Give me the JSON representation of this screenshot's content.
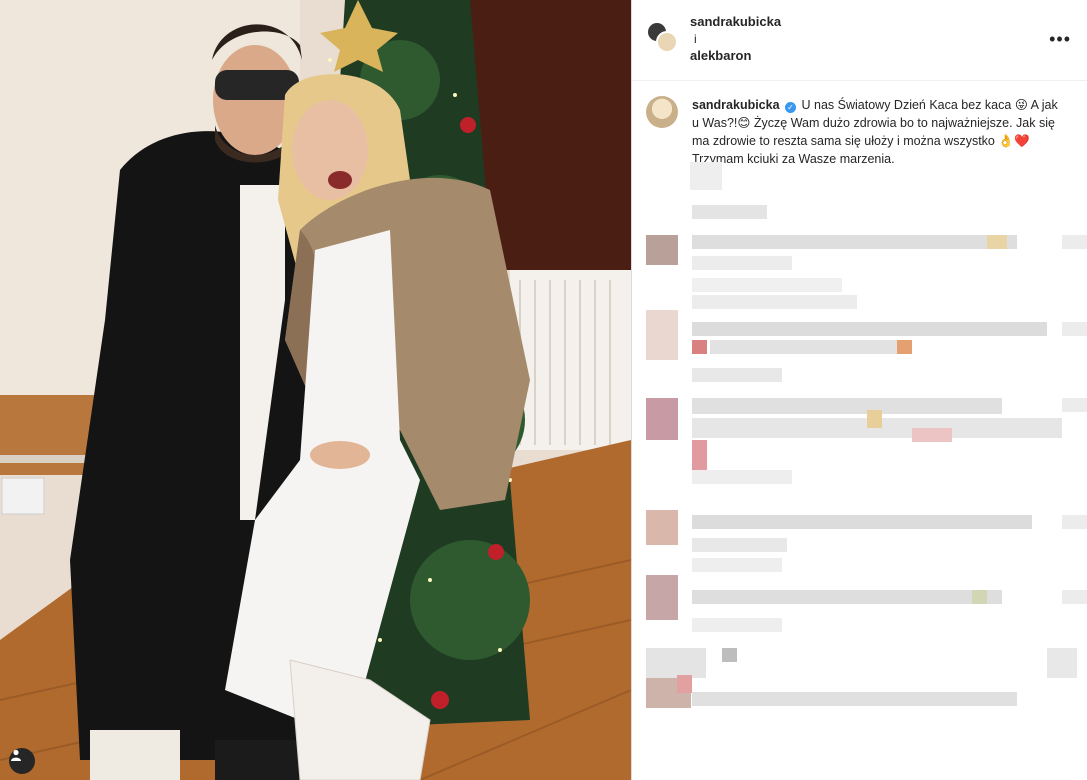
{
  "post": {
    "author": "sandrakubicka",
    "connector": "i",
    "coauthor": "alekbaron",
    "more_icon": "•••"
  },
  "caption": {
    "username": "sandrakubicka",
    "verified_icon": "✓",
    "text_part1": "U nas Światowy Dzień Kaca bez kaca ",
    "emoji1": "😜",
    "text_part2": " A jak u Was?!",
    "emoji2": "😊",
    "text_part3": " Życzę Wam dużo zdrowia bo to najważniejsze. Jak się ma zdrowie to reszta sama się ułoży i można wszystko ",
    "emoji3": "👌",
    "emoji4": "❤️",
    "text_part4": " Trzymam kciuki za Wasze marzenia."
  },
  "icons": {
    "tag": "user-tag-icon",
    "more": "more-options-icon",
    "verified": "verified-badge-icon"
  },
  "colors": {
    "verified": "#3897f0",
    "text": "#262626",
    "border": "#dbdbdb"
  }
}
